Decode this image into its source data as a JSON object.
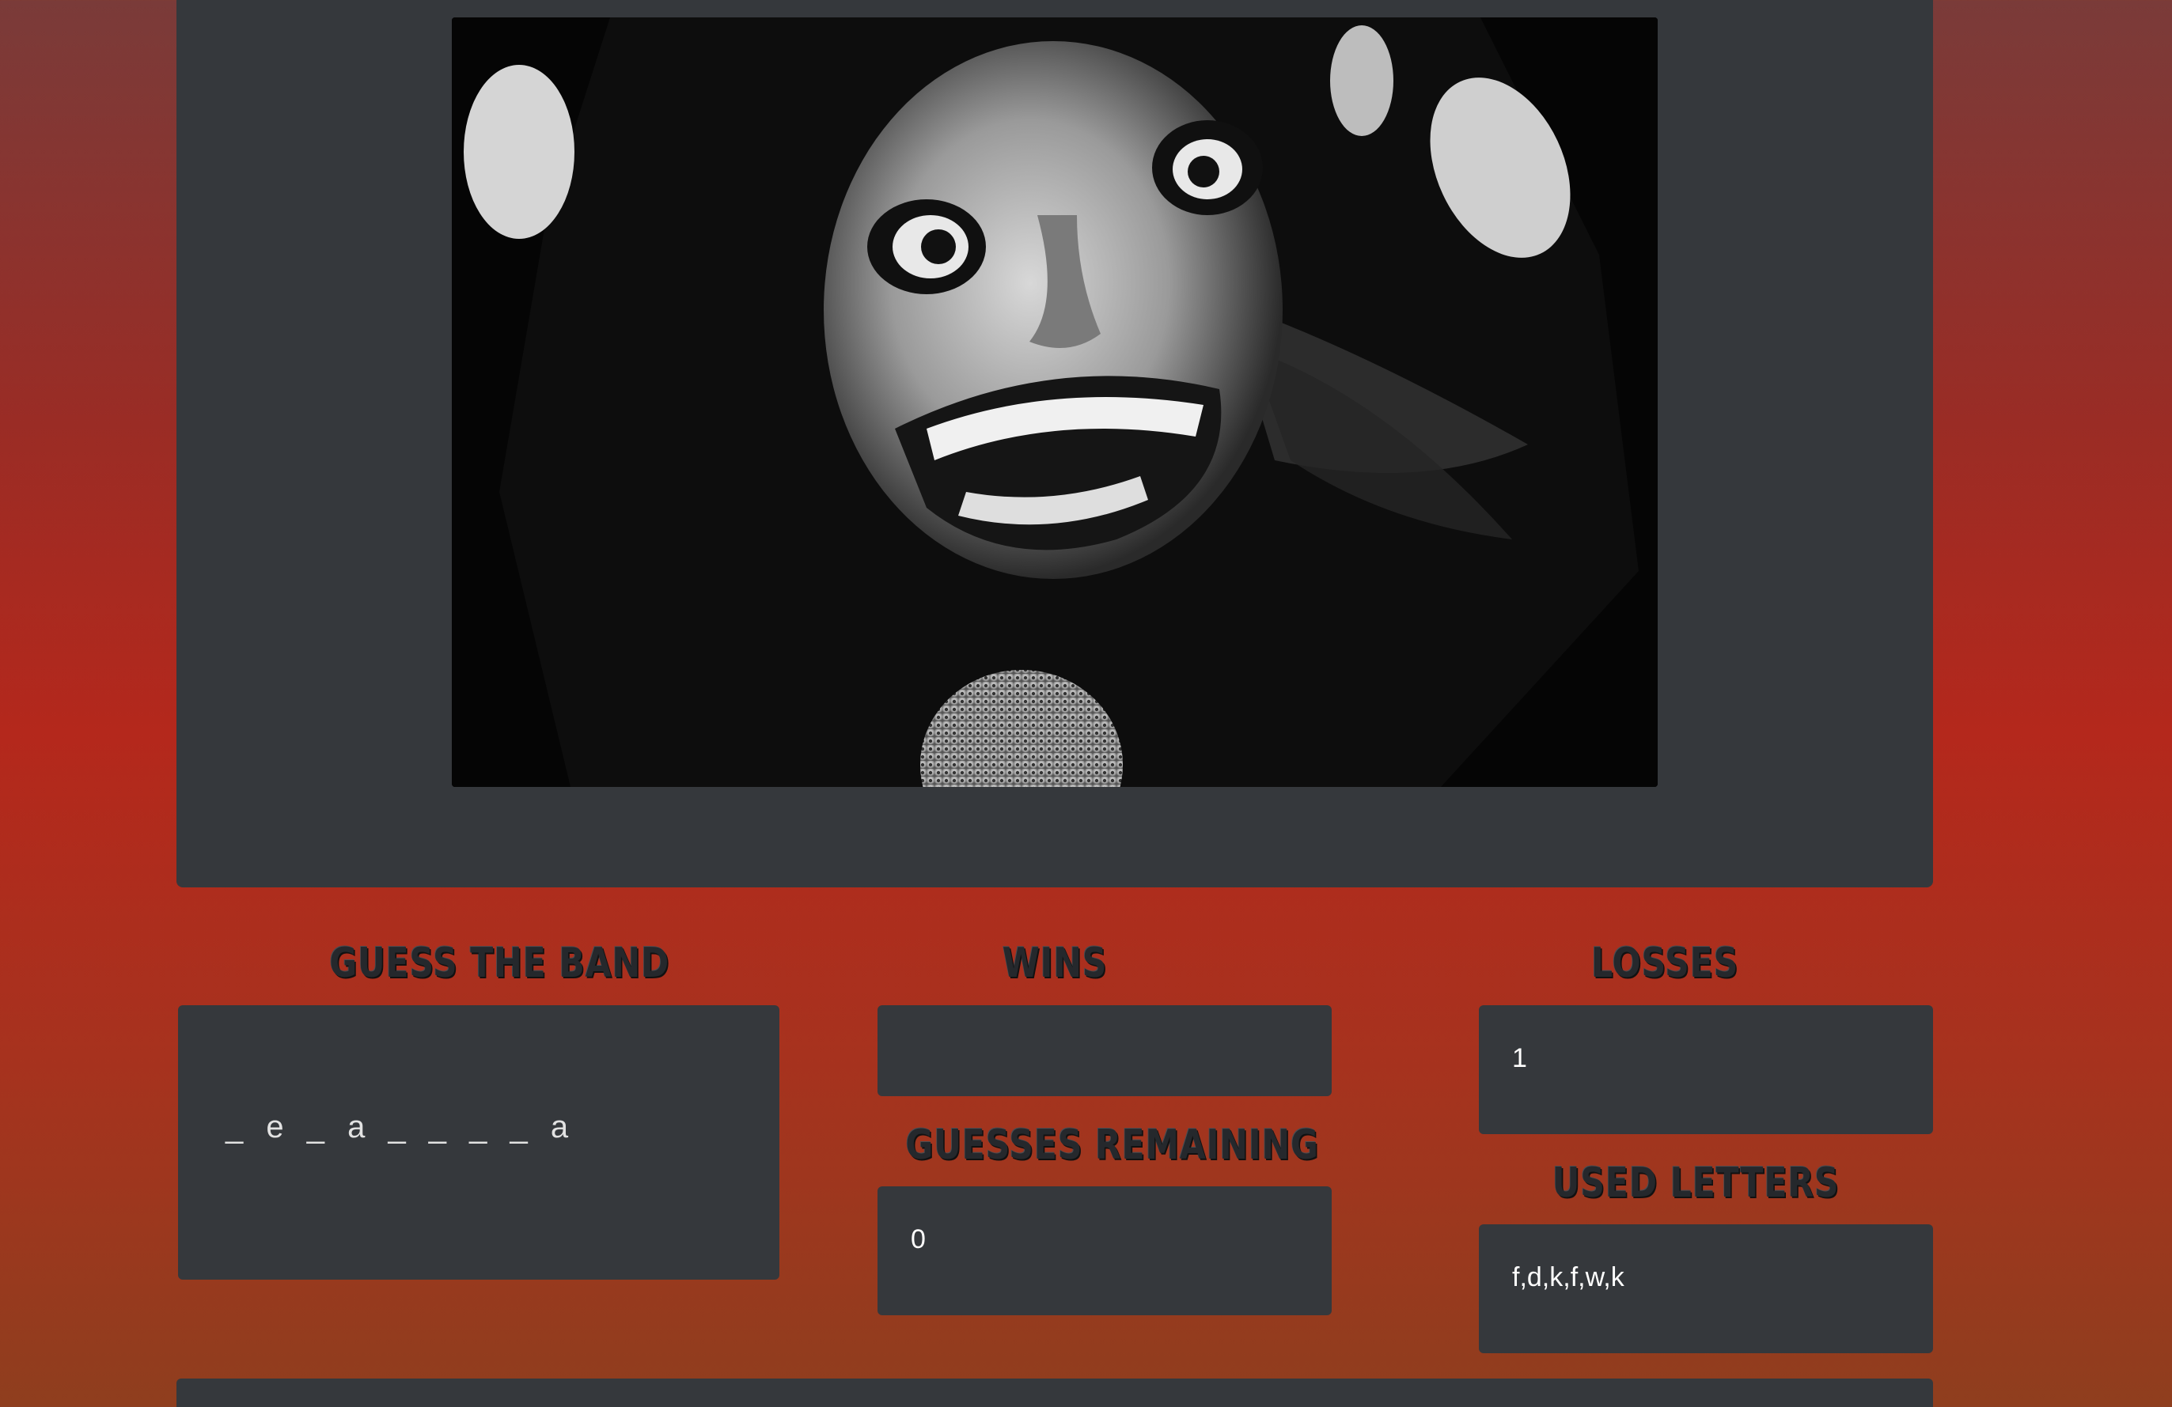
{
  "game": {
    "guess_heading": "GUESS THE BAND",
    "band_word": "_ e _ a _ _ _ _ a",
    "wins_heading": "WINS",
    "wins_value": "",
    "losses_heading": "LOSSES",
    "losses_value": "1",
    "guesses_heading": "GUESSES REMAINING",
    "guesses_value": "0",
    "used_heading": "USED LETTERS",
    "used_value": "f,d,k,f,w,k"
  },
  "colors": {
    "panel": "#35383c",
    "background_top": "#7a3b39",
    "background_mid": "#b4281c",
    "background_bottom": "#8f3e1e"
  }
}
